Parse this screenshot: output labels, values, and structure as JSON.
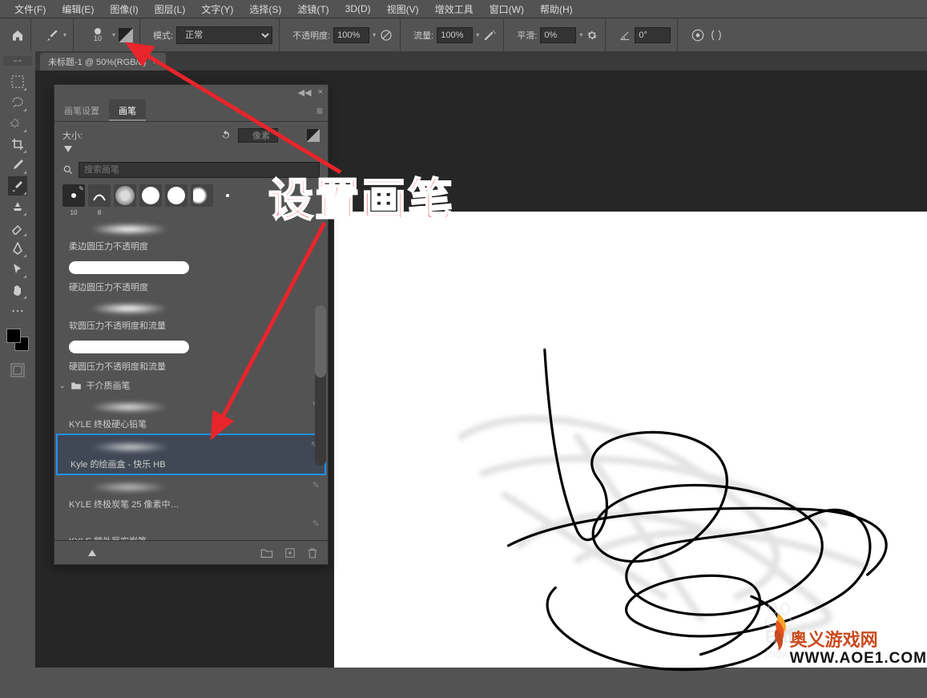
{
  "menu": [
    "文件(F)",
    "编辑(E)",
    "图像(I)",
    "图层(L)",
    "文字(Y)",
    "选择(S)",
    "滤镜(T)",
    "3D(D)",
    "视图(V)",
    "增效工具",
    "窗口(W)",
    "帮助(H)"
  ],
  "options": {
    "brush_size_num": "10",
    "mode_label": "模式:",
    "mode_value": "正常",
    "opacity_label": "不透明度:",
    "opacity_value": "100%",
    "flow_label": "流量:",
    "flow_value": "100%",
    "smoothing_label": "平滑:",
    "smoothing_value": "0%",
    "angle_value": "0°"
  },
  "doc_tab": {
    "title": "未标题-1 @ 50%(RGB/8)",
    "close": "×"
  },
  "panel": {
    "tab_settings": "画笔设置",
    "tab_brushes": "画笔",
    "size_label": "大小:",
    "size_unit": "像素",
    "search_placeholder": "搜索画笔",
    "thumbs": {
      "first_num": "10",
      "second_num": "8"
    },
    "brushes": [
      {
        "name": "柔边圆压力不透明度",
        "style": "soft"
      },
      {
        "name": "硬边圆压力不透明度",
        "style": "hard"
      },
      {
        "name": "软圆压力不透明度和流量",
        "style": "soft"
      },
      {
        "name": "硬圆压力不透明度和流量",
        "style": "hard"
      }
    ],
    "folder": "干介质画笔",
    "kyle": [
      {
        "name": "KYLE 终极硬心铅笔"
      },
      {
        "name": "Kyle 的绘画盒 - 快乐 HB",
        "selected": true
      },
      {
        "name": "KYLE 终极炭笔 25 像素中…"
      },
      {
        "name": "KYLE 额外厚实炭笔"
      }
    ]
  },
  "annotation": "设置画笔",
  "watermark": {
    "baidu_name": "Bai",
    "baidu_sub": "jingya",
    "aoe_text": "奥义游戏网",
    "aoe_url": "WWW.AOE1.COM"
  }
}
